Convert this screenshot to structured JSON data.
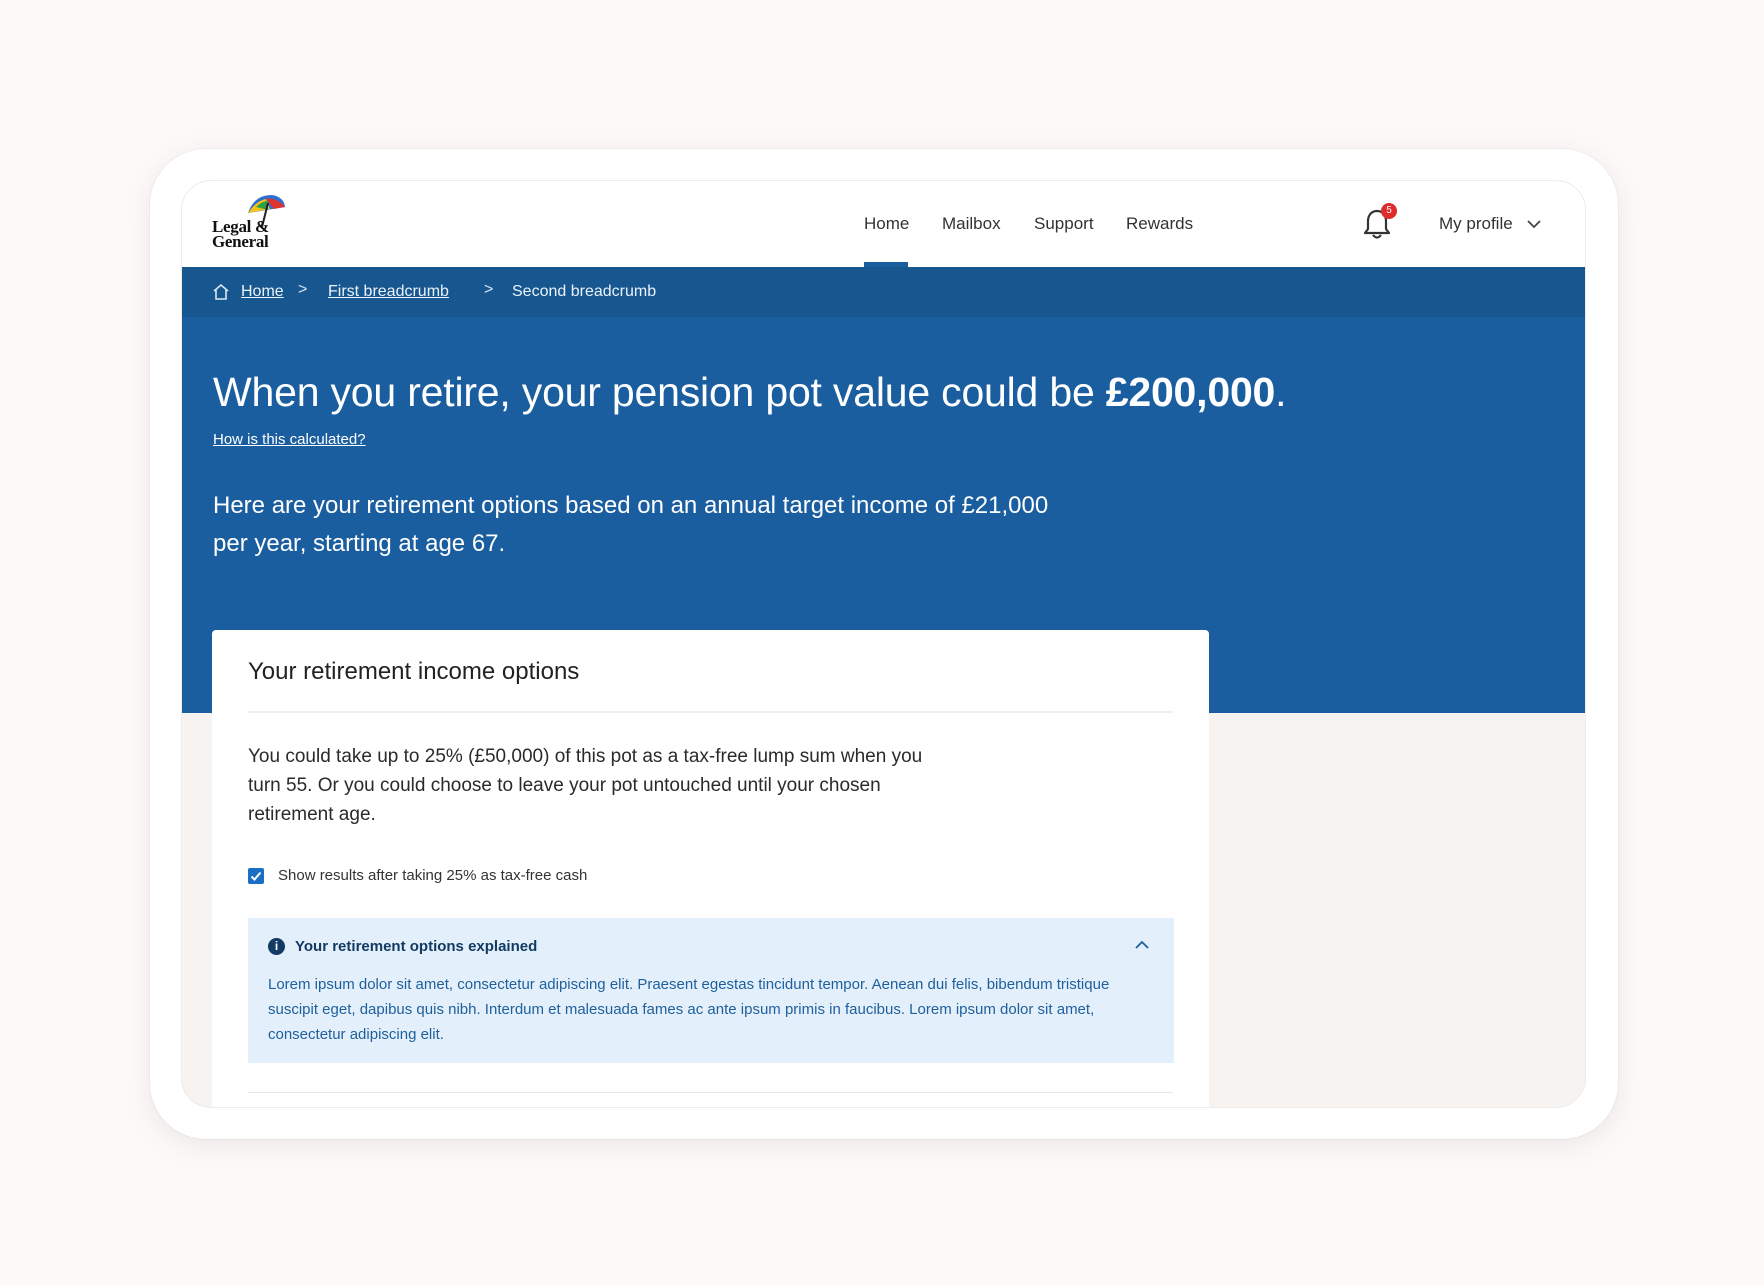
{
  "brand": {
    "logo_line1": "Legal &",
    "logo_line2": "General"
  },
  "nav": {
    "items": [
      {
        "label": "Home",
        "active": true
      },
      {
        "label": "Mailbox"
      },
      {
        "label": "Support"
      },
      {
        "label": "Rewards"
      }
    ],
    "notifications_badge": "5",
    "profile_label": "My profile"
  },
  "breadcrumb": {
    "items": [
      "Home",
      "First breadcrumb",
      "Second breadcrumb"
    ],
    "separator": ">"
  },
  "hero": {
    "title_prefix": "When you retire, your pension pot value could be ",
    "title_value": "£200,000",
    "title_suffix": ".",
    "how_link": "How is this calculated?",
    "subtitle": "Here are your retirement options based on an annual target income of £21,000 per year, starting at age 67."
  },
  "card": {
    "title": "Your retirement income options",
    "body": "You could take up to 25% (£50,000) of this pot as a tax-free lump sum when you turn 55. Or you could choose to leave your pot untouched until your chosen retirement age.",
    "checkbox_label": "Show results after taking 25% as tax-free cash",
    "checkbox_checked": true,
    "explainer": {
      "title": "Your retirement options explained",
      "body": "Lorem ipsum dolor sit amet, consectetur adipiscing elit. Praesent egestas tincidunt tempor. Aenean dui felis, bibendum tristique suscipit eget, dapibus quis nibh. Interdum et malesuada fames ac ante ipsum primis in faucibus. Lorem ipsum dolor sit amet, consectetur adipiscing elit.",
      "expanded": true
    }
  },
  "colors": {
    "primary_blue": "#1a5ea0",
    "breadcrumb_blue": "#18568f",
    "info_bg": "#e3f0fb",
    "badge_red": "#e02b2b"
  }
}
